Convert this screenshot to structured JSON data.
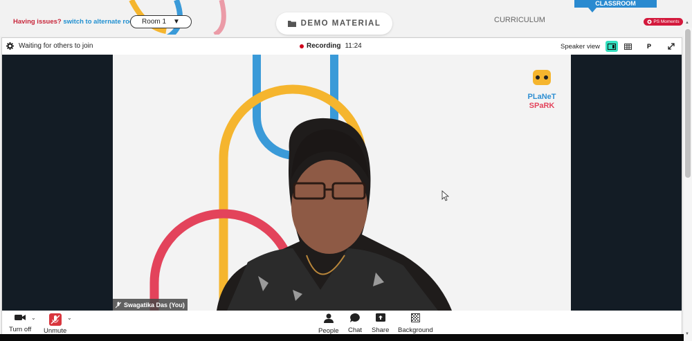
{
  "header": {
    "issues_text": "Having issues?",
    "switch_link": "switch to alternate room",
    "room_select_value": "Room 1",
    "demo_button_label": "DEMO MATERIAL",
    "curriculum_tab": "CURRICULUM",
    "classroom_tab": "CLASSROOM",
    "ps_moments_label": "PS Moments"
  },
  "meeting": {
    "waiting_text": "Waiting for others to join",
    "recording_label": "Recording",
    "recording_time": "11:24",
    "speaker_view_label": "Speaker view",
    "p_button": "P",
    "participant_name": "Swagatika Das (You)",
    "brand_logo_line1": "PLaNeT",
    "brand_logo_line2": "SPaRK"
  },
  "controls": {
    "turn_off": "Turn off",
    "unmute": "Unmute",
    "people": "People",
    "chat": "Chat",
    "share": "Share",
    "background": "Background"
  },
  "colors": {
    "accent_blue": "#2a8ad0",
    "danger_red": "#d3193c",
    "active_teal": "#34e0c0",
    "stage_dark": "#131c25"
  }
}
